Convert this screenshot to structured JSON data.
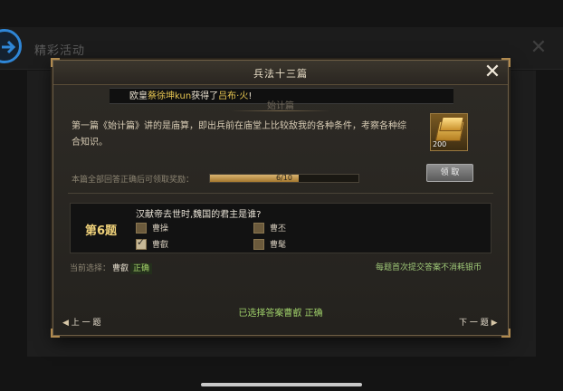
{
  "background": {
    "title": "精彩活动",
    "back_icon": "back-arrow-icon",
    "close_icon": "close-icon"
  },
  "dialog": {
    "title": "兵法十三篇",
    "close_icon": "close-icon",
    "notice": {
      "prefix": "欧皇",
      "player": "蔡徐坤kun",
      "middle": "获得了",
      "item": "吕布·火",
      "suffix": "!"
    },
    "chapter": "始计篇",
    "description": "第一篇《始计篇》讲的是庙算，即出兵前在庙堂上比较敌我的各种条件，考察各种综合知识。",
    "reward": {
      "icon": "gold-ingot-icon",
      "count": "200",
      "claim_label": "领 取"
    },
    "progress": {
      "label": "本篇全部回答正确后可领取奖励：",
      "text": "6/10",
      "fraction": 0.6
    },
    "question": {
      "number": "第6题",
      "text": "汉献帝去世时,魏国的君主是谁?",
      "options": [
        {
          "label": "曹操",
          "checked": false
        },
        {
          "label": "曹丕",
          "checked": false
        },
        {
          "label": "曹叡",
          "checked": true
        },
        {
          "label": "曹髦",
          "checked": false
        }
      ]
    },
    "current_selection": {
      "label": "当前选择：",
      "answer": "曹叡",
      "status": "正确"
    },
    "hint": "每题首次提交答案不消耗银币",
    "result": "已选择答案曹叡 正确",
    "prev_label": "上 一 题",
    "next_label": "下 一 题"
  },
  "colors": {
    "gold": "#e5c451",
    "correct": "#9fd06a",
    "back_button": "#2f86d6"
  }
}
